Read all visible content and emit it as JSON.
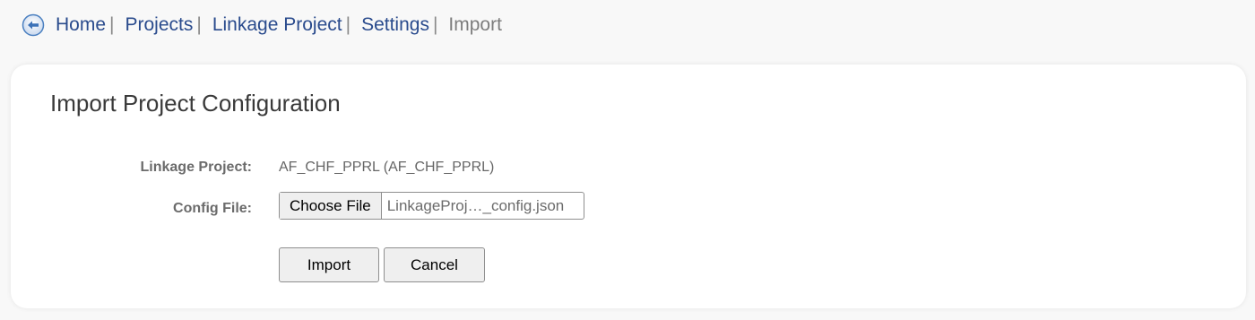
{
  "breadcrumb": {
    "back_icon": "back-arrow-circle-icon",
    "items": [
      {
        "label": "Home"
      },
      {
        "label": "Projects"
      },
      {
        "label": "Linkage Project"
      },
      {
        "label": "Settings"
      }
    ],
    "separator": "|",
    "current": "Import"
  },
  "panel": {
    "title": "Import Project Configuration",
    "project_label": "Linkage Project:",
    "project_value": "AF_CHF_PPRL (AF_CHF_PPRL)",
    "config_label": "Config File:",
    "choose_file_label": "Choose File",
    "file_name": "LinkageProj…_config.json",
    "import_label": "Import",
    "cancel_label": "Cancel"
  },
  "colors": {
    "link": "#2a4b8d",
    "muted": "#7d7d7d",
    "icon_blue": "#4a7fc0"
  }
}
